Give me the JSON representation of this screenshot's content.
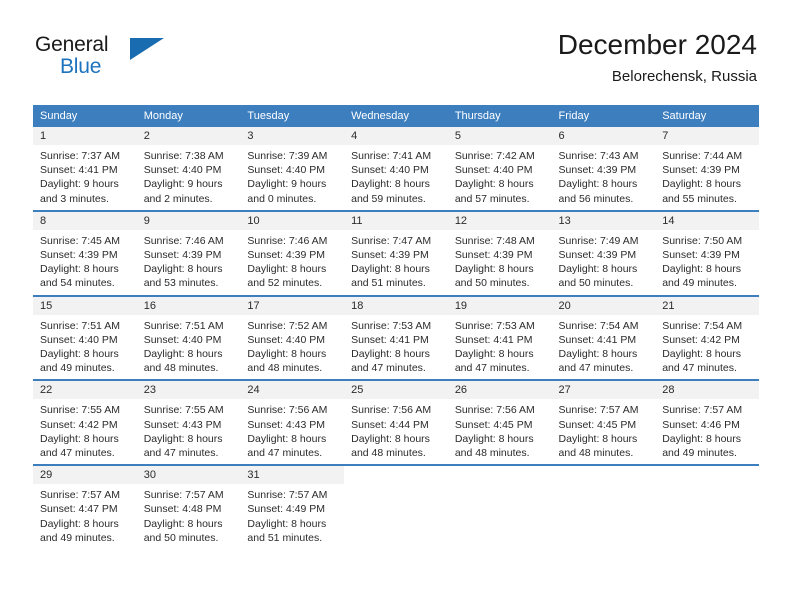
{
  "brand": {
    "name_dark": "General",
    "name_blue": "Blue",
    "logo_icon": "triangle-icon",
    "accent_color": "#1e73be"
  },
  "header": {
    "title": "December 2024",
    "subtitle": "Belorechensk, Russia"
  },
  "theme": {
    "header_bg": "#3d7ebe",
    "daynum_bg": "#f2f2f2",
    "text_color": "#2b2b2b",
    "cell_bg": "#ffffff"
  },
  "calendar": {
    "weekday_headers": [
      "Sunday",
      "Monday",
      "Tuesday",
      "Wednesday",
      "Thursday",
      "Friday",
      "Saturday"
    ],
    "weeks": [
      [
        {
          "day": "1",
          "sunrise": "Sunrise: 7:37 AM",
          "sunset": "Sunset: 4:41 PM",
          "daylight_1": "Daylight: 9 hours",
          "daylight_2": "and 3 minutes."
        },
        {
          "day": "2",
          "sunrise": "Sunrise: 7:38 AM",
          "sunset": "Sunset: 4:40 PM",
          "daylight_1": "Daylight: 9 hours",
          "daylight_2": "and 2 minutes."
        },
        {
          "day": "3",
          "sunrise": "Sunrise: 7:39 AM",
          "sunset": "Sunset: 4:40 PM",
          "daylight_1": "Daylight: 9 hours",
          "daylight_2": "and 0 minutes."
        },
        {
          "day": "4",
          "sunrise": "Sunrise: 7:41 AM",
          "sunset": "Sunset: 4:40 PM",
          "daylight_1": "Daylight: 8 hours",
          "daylight_2": "and 59 minutes."
        },
        {
          "day": "5",
          "sunrise": "Sunrise: 7:42 AM",
          "sunset": "Sunset: 4:40 PM",
          "daylight_1": "Daylight: 8 hours",
          "daylight_2": "and 57 minutes."
        },
        {
          "day": "6",
          "sunrise": "Sunrise: 7:43 AM",
          "sunset": "Sunset: 4:39 PM",
          "daylight_1": "Daylight: 8 hours",
          "daylight_2": "and 56 minutes."
        },
        {
          "day": "7",
          "sunrise": "Sunrise: 7:44 AM",
          "sunset": "Sunset: 4:39 PM",
          "daylight_1": "Daylight: 8 hours",
          "daylight_2": "and 55 minutes."
        }
      ],
      [
        {
          "day": "8",
          "sunrise": "Sunrise: 7:45 AM",
          "sunset": "Sunset: 4:39 PM",
          "daylight_1": "Daylight: 8 hours",
          "daylight_2": "and 54 minutes."
        },
        {
          "day": "9",
          "sunrise": "Sunrise: 7:46 AM",
          "sunset": "Sunset: 4:39 PM",
          "daylight_1": "Daylight: 8 hours",
          "daylight_2": "and 53 minutes."
        },
        {
          "day": "10",
          "sunrise": "Sunrise: 7:46 AM",
          "sunset": "Sunset: 4:39 PM",
          "daylight_1": "Daylight: 8 hours",
          "daylight_2": "and 52 minutes."
        },
        {
          "day": "11",
          "sunrise": "Sunrise: 7:47 AM",
          "sunset": "Sunset: 4:39 PM",
          "daylight_1": "Daylight: 8 hours",
          "daylight_2": "and 51 minutes."
        },
        {
          "day": "12",
          "sunrise": "Sunrise: 7:48 AM",
          "sunset": "Sunset: 4:39 PM",
          "daylight_1": "Daylight: 8 hours",
          "daylight_2": "and 50 minutes."
        },
        {
          "day": "13",
          "sunrise": "Sunrise: 7:49 AM",
          "sunset": "Sunset: 4:39 PM",
          "daylight_1": "Daylight: 8 hours",
          "daylight_2": "and 50 minutes."
        },
        {
          "day": "14",
          "sunrise": "Sunrise: 7:50 AM",
          "sunset": "Sunset: 4:39 PM",
          "daylight_1": "Daylight: 8 hours",
          "daylight_2": "and 49 minutes."
        }
      ],
      [
        {
          "day": "15",
          "sunrise": "Sunrise: 7:51 AM",
          "sunset": "Sunset: 4:40 PM",
          "daylight_1": "Daylight: 8 hours",
          "daylight_2": "and 49 minutes."
        },
        {
          "day": "16",
          "sunrise": "Sunrise: 7:51 AM",
          "sunset": "Sunset: 4:40 PM",
          "daylight_1": "Daylight: 8 hours",
          "daylight_2": "and 48 minutes."
        },
        {
          "day": "17",
          "sunrise": "Sunrise: 7:52 AM",
          "sunset": "Sunset: 4:40 PM",
          "daylight_1": "Daylight: 8 hours",
          "daylight_2": "and 48 minutes."
        },
        {
          "day": "18",
          "sunrise": "Sunrise: 7:53 AM",
          "sunset": "Sunset: 4:41 PM",
          "daylight_1": "Daylight: 8 hours",
          "daylight_2": "and 47 minutes."
        },
        {
          "day": "19",
          "sunrise": "Sunrise: 7:53 AM",
          "sunset": "Sunset: 4:41 PM",
          "daylight_1": "Daylight: 8 hours",
          "daylight_2": "and 47 minutes."
        },
        {
          "day": "20",
          "sunrise": "Sunrise: 7:54 AM",
          "sunset": "Sunset: 4:41 PM",
          "daylight_1": "Daylight: 8 hours",
          "daylight_2": "and 47 minutes."
        },
        {
          "day": "21",
          "sunrise": "Sunrise: 7:54 AM",
          "sunset": "Sunset: 4:42 PM",
          "daylight_1": "Daylight: 8 hours",
          "daylight_2": "and 47 minutes."
        }
      ],
      [
        {
          "day": "22",
          "sunrise": "Sunrise: 7:55 AM",
          "sunset": "Sunset: 4:42 PM",
          "daylight_1": "Daylight: 8 hours",
          "daylight_2": "and 47 minutes."
        },
        {
          "day": "23",
          "sunrise": "Sunrise: 7:55 AM",
          "sunset": "Sunset: 4:43 PM",
          "daylight_1": "Daylight: 8 hours",
          "daylight_2": "and 47 minutes."
        },
        {
          "day": "24",
          "sunrise": "Sunrise: 7:56 AM",
          "sunset": "Sunset: 4:43 PM",
          "daylight_1": "Daylight: 8 hours",
          "daylight_2": "and 47 minutes."
        },
        {
          "day": "25",
          "sunrise": "Sunrise: 7:56 AM",
          "sunset": "Sunset: 4:44 PM",
          "daylight_1": "Daylight: 8 hours",
          "daylight_2": "and 48 minutes."
        },
        {
          "day": "26",
          "sunrise": "Sunrise: 7:56 AM",
          "sunset": "Sunset: 4:45 PM",
          "daylight_1": "Daylight: 8 hours",
          "daylight_2": "and 48 minutes."
        },
        {
          "day": "27",
          "sunrise": "Sunrise: 7:57 AM",
          "sunset": "Sunset: 4:45 PM",
          "daylight_1": "Daylight: 8 hours",
          "daylight_2": "and 48 minutes."
        },
        {
          "day": "28",
          "sunrise": "Sunrise: 7:57 AM",
          "sunset": "Sunset: 4:46 PM",
          "daylight_1": "Daylight: 8 hours",
          "daylight_2": "and 49 minutes."
        }
      ],
      [
        {
          "day": "29",
          "sunrise": "Sunrise: 7:57 AM",
          "sunset": "Sunset: 4:47 PM",
          "daylight_1": "Daylight: 8 hours",
          "daylight_2": "and 49 minutes."
        },
        {
          "day": "30",
          "sunrise": "Sunrise: 7:57 AM",
          "sunset": "Sunset: 4:48 PM",
          "daylight_1": "Daylight: 8 hours",
          "daylight_2": "and 50 minutes."
        },
        {
          "day": "31",
          "sunrise": "Sunrise: 7:57 AM",
          "sunset": "Sunset: 4:49 PM",
          "daylight_1": "Daylight: 8 hours",
          "daylight_2": "and 51 minutes."
        },
        {
          "day": "",
          "sunrise": "",
          "sunset": "",
          "daylight_1": "",
          "daylight_2": ""
        },
        {
          "day": "",
          "sunrise": "",
          "sunset": "",
          "daylight_1": "",
          "daylight_2": ""
        },
        {
          "day": "",
          "sunrise": "",
          "sunset": "",
          "daylight_1": "",
          "daylight_2": ""
        },
        {
          "day": "",
          "sunrise": "",
          "sunset": "",
          "daylight_1": "",
          "daylight_2": ""
        }
      ]
    ]
  }
}
